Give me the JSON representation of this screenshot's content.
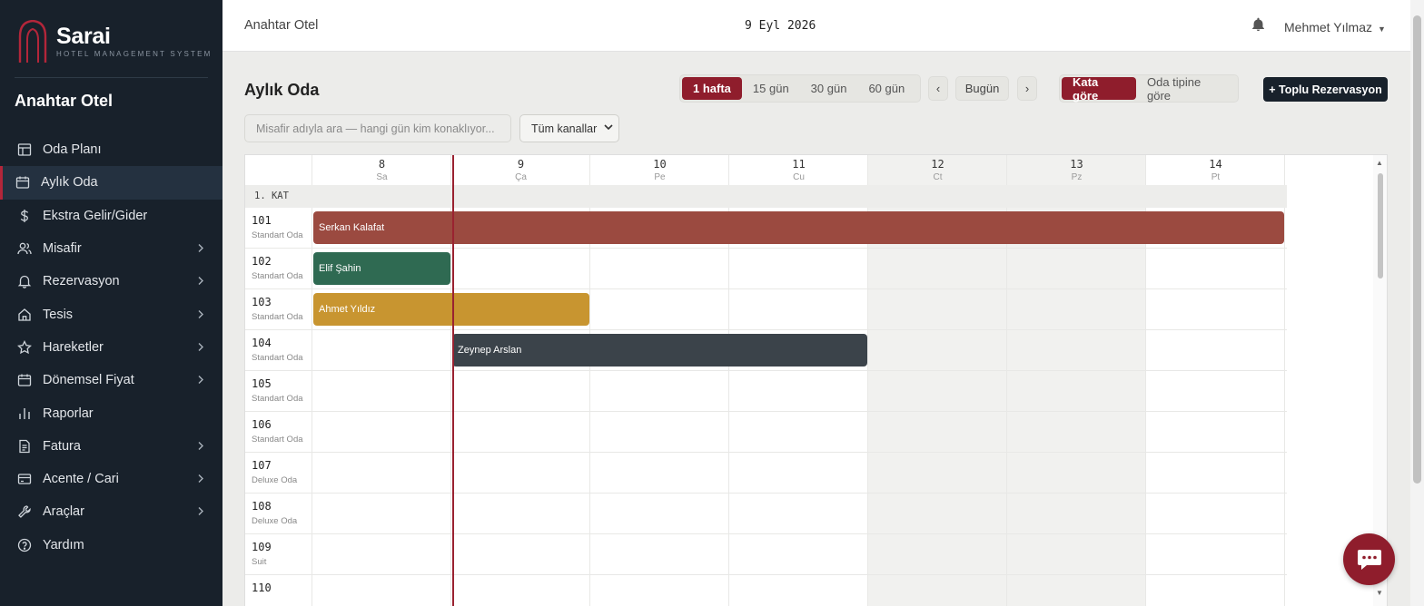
{
  "brand": {
    "name": "Sarai",
    "subtitle": "HOTEL MANAGEMENT SYSTEM"
  },
  "sidebar": {
    "hotel_name": "Anahtar Otel",
    "items": [
      {
        "label": "Oda Planı",
        "icon": "grid-icon",
        "has_children": false,
        "active": false
      },
      {
        "label": "Aylık Oda",
        "icon": "calendar-icon",
        "has_children": false,
        "active": true
      },
      {
        "label": "Ekstra Gelir/Gider",
        "icon": "dollar-icon",
        "has_children": false,
        "active": false
      },
      {
        "label": "Misafir",
        "icon": "users-icon",
        "has_children": true,
        "active": false
      },
      {
        "label": "Rezervasyon",
        "icon": "bell-icon",
        "has_children": true,
        "active": false
      },
      {
        "label": "Tesis",
        "icon": "home-icon",
        "has_children": true,
        "active": false
      },
      {
        "label": "Hareketler",
        "icon": "star-icon",
        "has_children": true,
        "active": false
      },
      {
        "label": "Dönemsel Fiyat",
        "icon": "calendar-icon",
        "has_children": true,
        "active": false
      },
      {
        "label": "Raporlar",
        "icon": "bar-chart-icon",
        "has_children": false,
        "active": false
      },
      {
        "label": "Fatura",
        "icon": "file-icon",
        "has_children": true,
        "active": false
      },
      {
        "label": "Acente / Cari",
        "icon": "credit-card-icon",
        "has_children": true,
        "active": false
      },
      {
        "label": "Araçlar",
        "icon": "wrench-icon",
        "has_children": true,
        "active": false
      },
      {
        "label": "Yardım",
        "icon": "help-circle-icon",
        "has_children": false,
        "active": false
      }
    ]
  },
  "topbar": {
    "hotel": "Anahtar Otel",
    "date": "9 Eyl 2026",
    "user": "Mehmet Yılmaz"
  },
  "page": {
    "title": "Aylık Oda"
  },
  "range_options": [
    "1 hafta",
    "15 gün",
    "30 gün",
    "60 gün"
  ],
  "range_selected": "1 hafta",
  "nav": {
    "prev": "‹",
    "today": "Bugün",
    "next": "›"
  },
  "group_options": [
    "Kata göre",
    "Oda tipine göre"
  ],
  "group_selected": "Kata göre",
  "bulk_button": "+ Toplu Rezervasyon",
  "search": {
    "placeholder": "Misafir adıyla ara — hangi gün kim konaklıyor..."
  },
  "channel": {
    "value": "Tüm kanallar"
  },
  "calendar": {
    "days": [
      {
        "num": "8",
        "name": "Sa",
        "weekend": false
      },
      {
        "num": "9",
        "name": "Ça",
        "weekend": false
      },
      {
        "num": "10",
        "name": "Pe",
        "weekend": false
      },
      {
        "num": "11",
        "name": "Cu",
        "weekend": false
      },
      {
        "num": "12",
        "name": "Ct",
        "weekend": true
      },
      {
        "num": "13",
        "name": "Pz",
        "weekend": true
      },
      {
        "num": "14",
        "name": "Pt",
        "weekend": false
      }
    ],
    "floor_label": "1. KAT",
    "rooms": [
      {
        "num": "101",
        "type": "Standart Oda"
      },
      {
        "num": "102",
        "type": "Standart Oda"
      },
      {
        "num": "103",
        "type": "Standart Oda"
      },
      {
        "num": "104",
        "type": "Standart Oda"
      },
      {
        "num": "105",
        "type": "Standart Oda"
      },
      {
        "num": "106",
        "type": "Standart Oda"
      },
      {
        "num": "107",
        "type": "Deluxe Oda"
      },
      {
        "num": "108",
        "type": "Deluxe Oda"
      },
      {
        "num": "109",
        "type": "Suit"
      },
      {
        "num": "110",
        "type": ""
      }
    ],
    "reservations": [
      {
        "guest": "Serkan Kalafat",
        "room": "101",
        "start_day": 0,
        "days": 7,
        "color": "#9b4a40"
      },
      {
        "guest": "Elif Şahin",
        "room": "102",
        "start_day": 0,
        "days": 1,
        "color": "#2f6a52"
      },
      {
        "guest": "Ahmet Yıldız",
        "room": "103",
        "start_day": 0,
        "days": 2,
        "color": "#c89530"
      },
      {
        "guest": "Zeynep Arslan",
        "room": "104",
        "start_day": 1,
        "days": 3,
        "color": "#3b434a"
      }
    ]
  },
  "colors": {
    "accent": "#8f1d2c",
    "sidebar": "#18212b",
    "today_line": "#9a2230"
  }
}
